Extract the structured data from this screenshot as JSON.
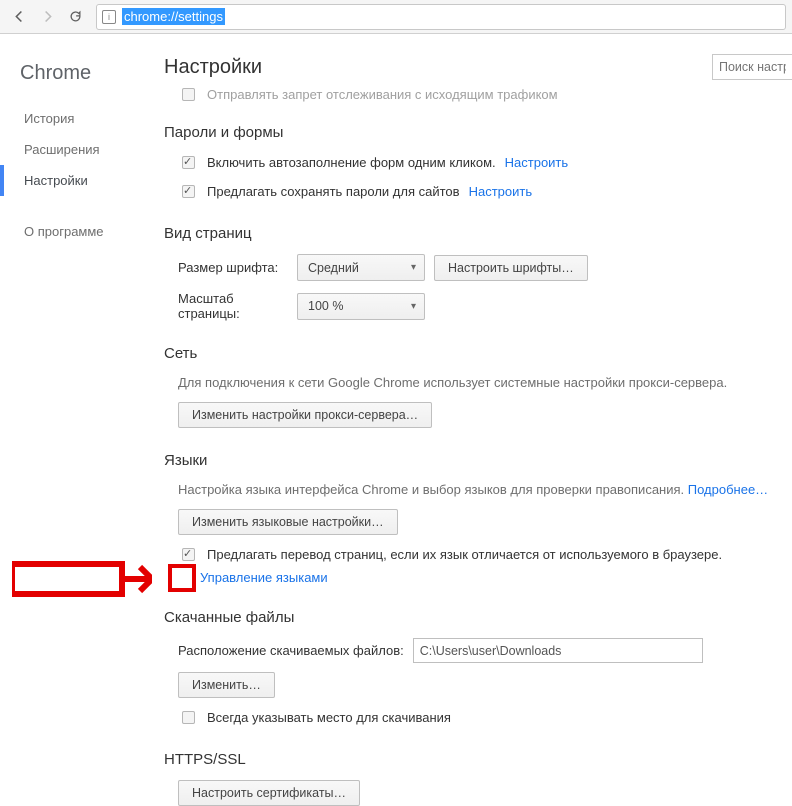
{
  "url": "chrome://settings",
  "brand": "Chrome",
  "sidebar": {
    "items": [
      {
        "label": "История",
        "active": false
      },
      {
        "label": "Расширения",
        "active": false
      },
      {
        "label": "Настройки",
        "active": true
      }
    ],
    "about": "О программе"
  },
  "title": "Настройки",
  "search_placeholder": "Поиск настро",
  "truncated_line": "Отправлять запрет отслеживания с исходящим трафиком",
  "passwords": {
    "heading": "Пароли и формы",
    "autofill": "Включить автозаполнение форм одним кликом.",
    "autofill_cfg": "Настроить",
    "save_pw": "Предлагать сохранять пароли для сайтов",
    "save_pw_cfg": "Настроить"
  },
  "appearance": {
    "heading": "Вид страниц",
    "font_label": "Размер шрифта:",
    "font_value": "Средний",
    "font_btn": "Настроить шрифты…",
    "zoom_label": "Масштаб страницы:",
    "zoom_value": "100 %"
  },
  "network": {
    "heading": "Сеть",
    "desc": "Для подключения к сети Google Chrome использует системные настройки прокси-сервера.",
    "btn": "Изменить настройки прокси-сервера…"
  },
  "languages": {
    "heading": "Языки",
    "desc_a": "Настройка языка интерфейса Chrome и выбор языков для проверки правописания. ",
    "desc_link": "Подробнее…",
    "btn": "Изменить языковые настройки…",
    "translate": "Предлагать перевод страниц, если их язык отличается от используемого в браузере.",
    "manage": "Управление языками"
  },
  "downloads": {
    "heading": "Скачанные файлы",
    "path_label": "Расположение скачиваемых файлов:",
    "path_value": "C:\\Users\\user\\Downloads",
    "change": "Изменить…",
    "ask": "Всегда указывать место для скачивания"
  },
  "https": {
    "heading": "HTTPS/SSL",
    "btn": "Настроить сертификаты…"
  }
}
